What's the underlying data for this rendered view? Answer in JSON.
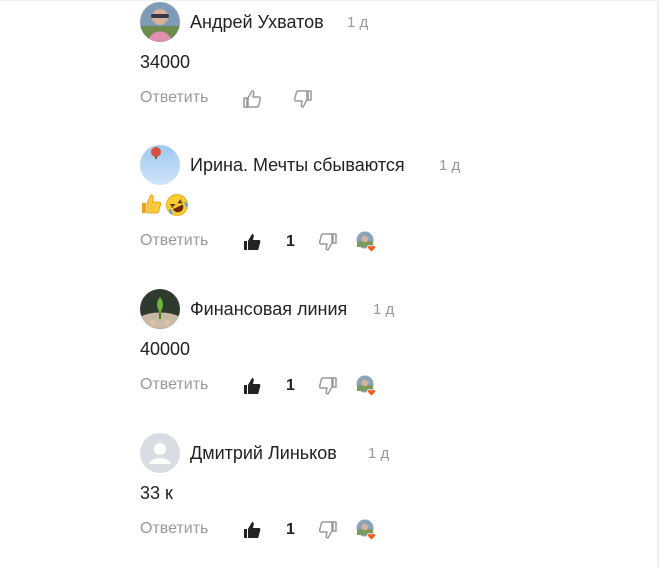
{
  "comments": [
    {
      "author": "Андрей Ухватов",
      "time": "1 д",
      "text": "34000",
      "avatar_icon": "user-photo-avatar",
      "reply_label": "Ответить",
      "liked": false,
      "likes": ""
    },
    {
      "author": "Ирина. Мечты сбываются",
      "time": "1 д",
      "text": "",
      "emojis": [
        "thumbs-up-emoji",
        "rolling-on-floor-laughing-emoji"
      ],
      "avatar_icon": "sky-balloon-avatar",
      "reply_label": "Ответить",
      "liked": true,
      "likes": "1"
    },
    {
      "author": "Финансовая линия",
      "time": "1 д",
      "text": "40000",
      "avatar_icon": "plant-hands-avatar",
      "reply_label": "Ответить",
      "liked": true,
      "likes": "1"
    },
    {
      "author": "Дмитрий Линьков",
      "time": "1 д",
      "text": "33 к",
      "avatar_icon": "default-user-avatar",
      "reply_label": "Ответить",
      "liked": true,
      "likes": "1"
    }
  ],
  "colors": {
    "text": "#222222",
    "muted": "#999999",
    "heart": "#ff5a1f"
  }
}
